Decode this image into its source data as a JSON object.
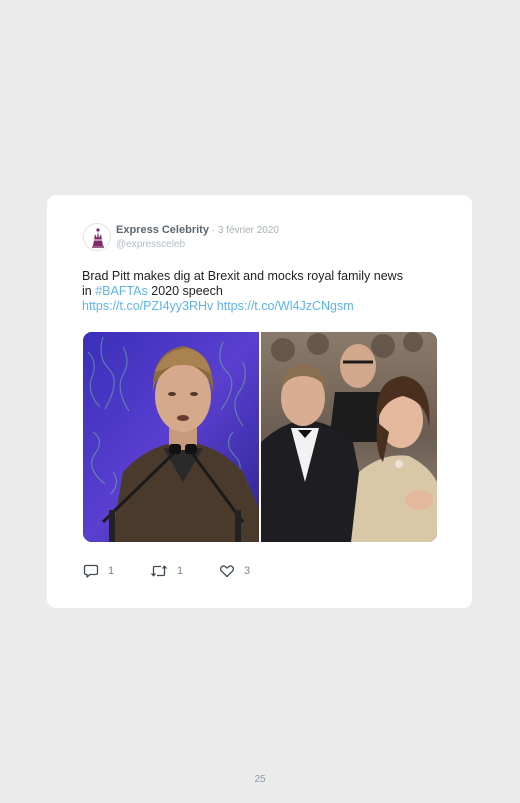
{
  "tweet": {
    "author_name": "Express Celebrity",
    "separator": " · ",
    "date": "3 février 2020",
    "handle": "@expressceleb",
    "text_line1": "Brad Pitt makes dig at Brexit and mocks royal family news",
    "text_line2_prefix": "in ",
    "hashtag": "#BAFTAs",
    "text_line2_suffix": " 2020 speech",
    "link1": "https://t.co/PZI4yy3RHv",
    "link_space": " ",
    "link2": "https://t.co/Wl4JzCNgsm"
  },
  "actions": {
    "reply_icon": "speech-bubble-icon",
    "reply_count": "1",
    "retweet_icon": "retweet-icon",
    "retweet_count": "1",
    "like_icon": "heart-icon",
    "like_count": "3"
  },
  "page_number": "25",
  "colors": {
    "background": "#ebebeb",
    "card": "#ffffff",
    "link": "#5db4ea",
    "text": "#222222",
    "muted": "#a7b1b8",
    "page_number": "#8e9ab0"
  }
}
